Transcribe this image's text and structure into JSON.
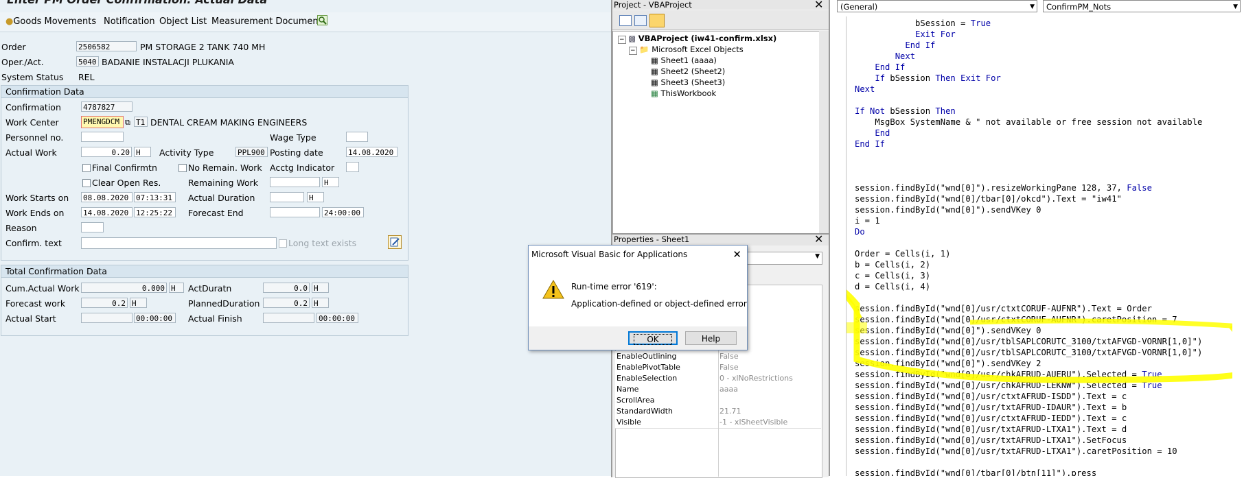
{
  "sap": {
    "title": "Enter PM Order Confirmation: Actual Data",
    "toolbar": [
      "Goods Movements",
      "Notification",
      "Object List",
      "Measurement Documents"
    ],
    "header": {
      "order_label": "Order",
      "order_value": "2506582",
      "order_desc": "PM STORAGE 2 TANK 740 MH",
      "oper_label": "Oper./Act.",
      "oper_value": "5040",
      "oper_desc": "BADANIE INSTALACJI PLUKANIA",
      "status_label": "System Status",
      "status_value": "REL"
    },
    "confirmation": {
      "title": "Confirmation Data",
      "confirmation_label": "Confirmation",
      "confirmation_value": "4787827",
      "work_center_label": "Work Center",
      "work_center_value": "PMENGDCM",
      "work_center_plant": "T1",
      "work_center_desc": "DENTAL CREAM MAKING ENGINEERS",
      "personnel_label": "Personnel no.",
      "wage_type_label": "Wage Type",
      "actual_work_label": "Actual Work",
      "actual_work_value": "0.20",
      "actual_work_unit": "H",
      "activity_type_label": "Activity Type",
      "activity_type_value": "PPL900",
      "posting_date_label": "Posting date",
      "posting_date_value": "14.08.2020",
      "final_confirm_label": "Final Confirmtn",
      "no_remain_label": "No Remain. Work",
      "acctg_label": "Acctg Indicator",
      "clear_open_label": "Clear Open Res.",
      "remaining_label": "Remaining Work",
      "remaining_unit": "H",
      "work_starts_label": "Work Starts on",
      "work_starts_date": "08.08.2020",
      "work_starts_time": "07:13:31",
      "actual_duration_label": "Actual Duration",
      "actual_duration_unit": "H",
      "work_ends_label": "Work Ends on",
      "work_ends_date": "14.08.2020",
      "work_ends_time": "12:25:22",
      "forecast_end_label": "Forecast End",
      "forecast_end_time": "24:00:00",
      "reason_label": "Reason",
      "confirm_text_label": "Confirm. text",
      "long_text_label": "Long text exists"
    },
    "total": {
      "title": "Total Confirmation Data",
      "cum_actual_label": "Cum.Actual Work",
      "cum_actual_value": "0.000",
      "cum_actual_unit": "H",
      "act_duratn_label": "ActDuratn",
      "act_duratn_value": "0.0",
      "act_duratn_unit": "H",
      "forecast_work_label": "Forecast work",
      "forecast_work_value": "0.2",
      "forecast_work_unit": "H",
      "planned_duration_label": "PlannedDuration",
      "planned_duration_value": "0.2",
      "planned_duration_unit": "H",
      "actual_start_label": "Actual Start",
      "actual_start_time": "00:00:00",
      "actual_finish_label": "Actual Finish",
      "actual_finish_time": "00:00:00"
    }
  },
  "project": {
    "title": "Project - VBAProject",
    "root": "VBAProject (iw41-confirm.xlsx)",
    "folder": "Microsoft Excel Objects",
    "items": [
      "Sheet1 (aaaa)",
      "Sheet2 (Sheet2)",
      "Sheet3 (Sheet3)",
      "ThisWorkbook"
    ]
  },
  "properties": {
    "title": "Properties - Sheet1",
    "rows": [
      {
        "name": "EnableOutlining",
        "value": "False"
      },
      {
        "name": "EnablePivotTable",
        "value": "False"
      },
      {
        "name": "EnableSelection",
        "value": "0 - xlNoRestrictions"
      },
      {
        "name": "Name",
        "value": "aaaa"
      },
      {
        "name": "ScrollArea",
        "value": ""
      },
      {
        "name": "StandardWidth",
        "value": "21.71"
      },
      {
        "name": "Visible",
        "value": "-1 - xlSheetVisible"
      }
    ]
  },
  "code": {
    "object_combo": "(General)",
    "proc_combo": "ConfirmPM_Nots",
    "lines": [
      "            bSession = True",
      "            Exit For",
      "          End If",
      "        Next",
      "    End If",
      "    If bSession Then Exit For",
      "Next",
      "",
      "If Not bSession Then",
      "    MsgBox SystemName & \" not available or free session not available",
      "    End",
      "End If",
      "",
      "",
      "",
      "session.findById(\"wnd[0]\").resizeWorkingPane 128, 37, False",
      "session.findById(\"wnd[0]/tbar[0]/okcd\").Text = \"iw41\"",
      "session.findById(\"wnd[0]\").sendVKey 0",
      "i = 1",
      "Do",
      "",
      "Order = Cells(i, 1)",
      "b = Cells(i, 2)",
      "c = Cells(i, 3)",
      "d = Cells(i, 4)",
      "",
      "session.findById(\"wnd[0]/usr/ctxtCORUF-AUFNR\").Text = Order",
      "session.findById(\"wnd[0]/usr/ctxtCORUF-AUFNR\").caretPosition = 7",
      "session.findById(\"wnd[0]\").sendVKey 0",
      "session.findById(\"wnd[0]/usr/tblSAPLCORUTC_3100/txtAFVGD-VORNR[1,0]\")",
      "session.findById(\"wnd[0]/usr/tblSAPLCORUTC_3100/txtAFVGD-VORNR[1,0]\")",
      "session.findById(\"wnd[0]\").sendVKey 2",
      "session.findById(\"wnd[0]/usr/chkAFRUD-AUERU\").Selected = True",
      "session.findById(\"wnd[0]/usr/chkAFRUD-LEKNW\").Selected = True",
      "session.findById(\"wnd[0]/usr/ctxtAFRUD-ISDD\").Text = c",
      "session.findById(\"wnd[0]/usr/txtAFRUD-IDAUR\").Text = b",
      "session.findById(\"wnd[0]/usr/ctxtAFRUD-IEDD\").Text = c",
      "session.findById(\"wnd[0]/usr/txtAFRUD-LTXA1\").Text = d",
      "session.findById(\"wnd[0]/usr/txtAFRUD-LTXA1\").SetFocus",
      "session.findById(\"wnd[0]/usr/txtAFRUD-LTXA1\").caretPosition = 10",
      "",
      "session.findById(\"wnd[0]/tbar[0]/btn[11]\").press",
      "   i = i + 1"
    ]
  },
  "dialog": {
    "title": "Microsoft Visual Basic for Applications",
    "error_line": "Run-time error '619':",
    "message": "Application-defined or object-defined error",
    "ok_label": "OK",
    "help_label": "Help"
  },
  "colors": {
    "highlight": "#ffff00",
    "sap_bg": "#e9f1f6",
    "keyword": "#0000a8"
  }
}
